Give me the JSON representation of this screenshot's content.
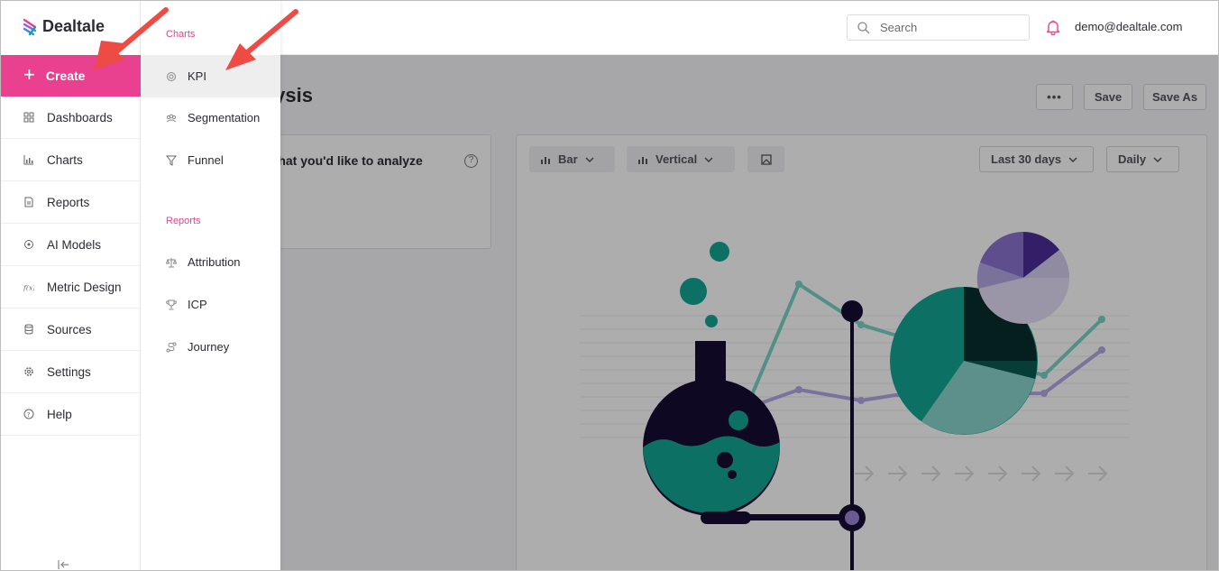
{
  "app": {
    "brand": "Dealtale",
    "accent_color": "#e9408f"
  },
  "header": {
    "search_placeholder": "Search",
    "user_email": "demo@dealtale.com"
  },
  "sidebar": {
    "create_label": "Create",
    "items": [
      {
        "label": "Dashboards",
        "icon": "grid-icon"
      },
      {
        "label": "Charts",
        "icon": "bar-chart-icon"
      },
      {
        "label": "Reports",
        "icon": "document-icon"
      },
      {
        "label": "AI Models",
        "icon": "ai-icon"
      },
      {
        "label": "Metric Design",
        "icon": "function-icon"
      },
      {
        "label": "Sources",
        "icon": "database-icon"
      },
      {
        "label": "Settings",
        "icon": "gear-icon"
      },
      {
        "label": "Help",
        "icon": "help-icon"
      }
    ]
  },
  "submenu": {
    "charts_section": "Charts",
    "charts_items": [
      {
        "label": "KPI",
        "icon": "kpi-icon"
      },
      {
        "label": "Segmentation",
        "icon": "segmentation-icon"
      },
      {
        "label": "Funnel",
        "icon": "funnel-icon"
      }
    ],
    "reports_section": "Reports",
    "reports_items": [
      {
        "label": "Attribution",
        "icon": "scale-icon"
      },
      {
        "label": "ICP",
        "icon": "trophy-icon"
      },
      {
        "label": "Journey",
        "icon": "journey-icon"
      }
    ]
  },
  "main": {
    "page_title_partial": "lysis",
    "more_label": "•••",
    "save_label": "Save",
    "save_as_label": "Save As",
    "query_prompt_partial": "s that you'd like to analyze",
    "help_glyph": "?",
    "chart_type": "Bar",
    "orientation": "Vertical",
    "date_range": "Last 30 days",
    "granularity": "Daily"
  }
}
